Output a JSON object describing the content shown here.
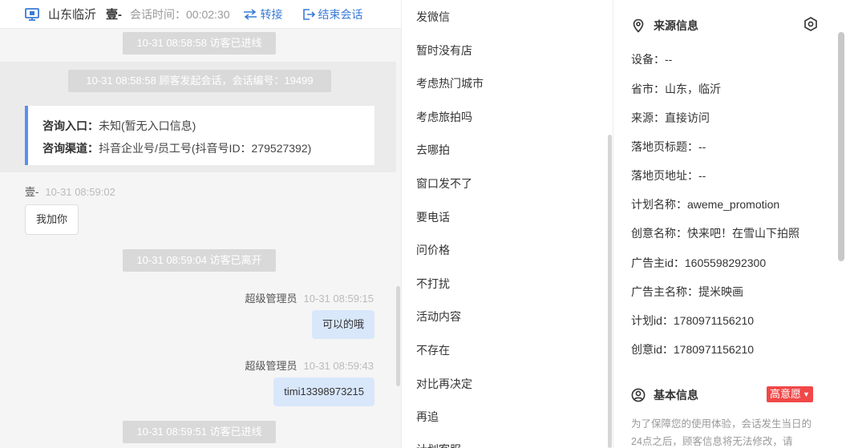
{
  "header": {
    "location": "山东临沂",
    "visitor_name": "壹-",
    "session_label": "会话时间：",
    "session_time": "00:02:30",
    "transfer_label": "转接",
    "end_label": "结束会话"
  },
  "chat": {
    "notice_1": "10-31 08:58:58 访客已进线",
    "notice_2": "10-31 08:58:58 顾客发起会话，会话编号：19499",
    "entry_label": "咨询入口：",
    "entry_value": "未知(暂无入口信息)",
    "channel_label": "咨询渠道：",
    "channel_value": "抖音企业号/员工号(抖音号ID：279527392)",
    "visitor_msg": {
      "name": "壹-",
      "time": "10-31 08:59:02",
      "text": "我加你"
    },
    "notice_3": "10-31 08:59:04 访客已离开",
    "agent_msg_1": {
      "name": "超级管理员",
      "time": "10-31 08:59:15",
      "text": "可以的哦"
    },
    "agent_msg_2": {
      "name": "超级管理员",
      "time": "10-31 08:59:43",
      "text": "timi13398973215"
    },
    "notice_4": "10-31 08:59:51 访客已进线"
  },
  "phrases": [
    "发微信",
    "暂时没有店",
    "考虑热门城市",
    "考虑旅拍吗",
    "去哪拍",
    "窗口发不了",
    "要电话",
    "问价格",
    "不打扰",
    "活动内容",
    "不存在",
    "对比再决定",
    "再追",
    "计划客服"
  ],
  "source_info": {
    "title": "来源信息",
    "device": "设备：--",
    "province": "省市：山东，临沂",
    "source": "来源：直接访问",
    "landing_title": "落地页标题：--",
    "landing_url": "落地页地址：--",
    "plan_name": "计划名称：aweme_promotion",
    "creative_name": "创意名称：快来吧！在雪山下拍照",
    "advertiser_id": "广告主id：1605598292300",
    "advertiser_name": "广告主名称：提米映画",
    "plan_id": "计划id：1780971156210",
    "creative_id": "创意id：1780971156210"
  },
  "basic_info": {
    "title": "基本信息",
    "intent": "高意愿",
    "notice": "为了保障您的使用体验，会话发生当日的24点之后，顾客信息将无法修改，请"
  },
  "colors": {
    "accent": "#3a7bd5",
    "badge": "#f04848",
    "bubble_agent": "#d9e7fb",
    "card_border": "#5b8ff0"
  }
}
